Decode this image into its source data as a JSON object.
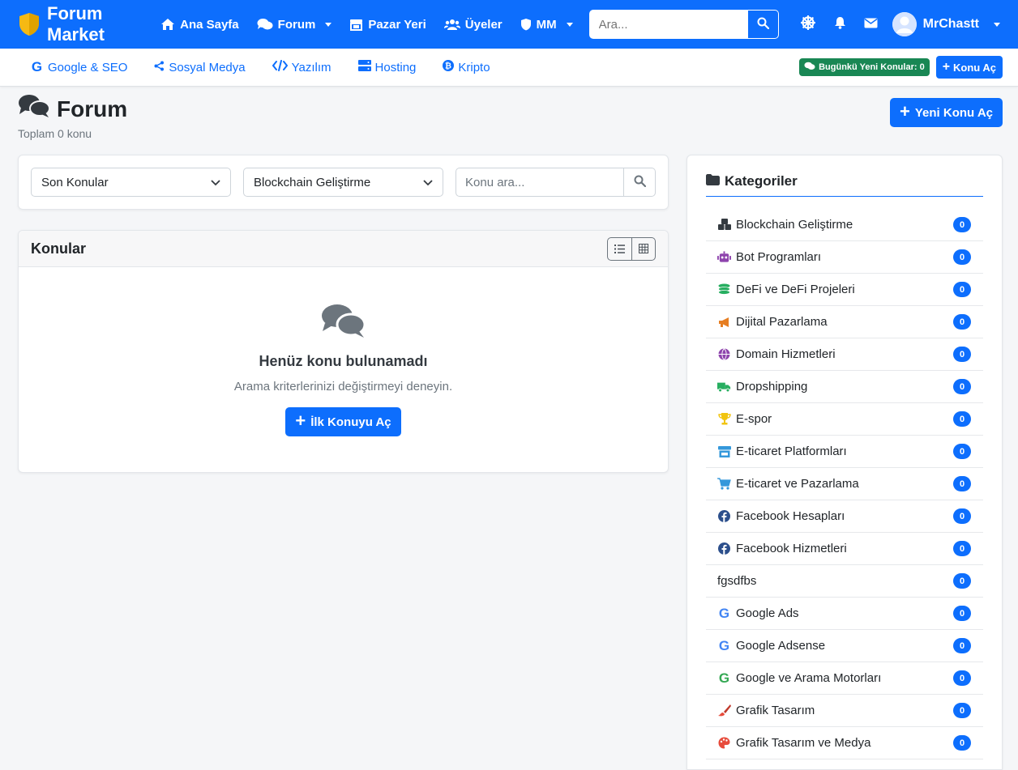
{
  "brand": {
    "name": "Forum Market"
  },
  "topnav": {
    "items": [
      {
        "label": "Ana Sayfa",
        "icon": "home-icon"
      },
      {
        "label": "Forum",
        "icon": "comments-icon",
        "dropdown": true
      },
      {
        "label": "Pazar Yeri",
        "icon": "store-icon"
      },
      {
        "label": "Üyeler",
        "icon": "users-icon"
      },
      {
        "label": "MM",
        "icon": "shield-icon",
        "dropdown": true
      }
    ],
    "search_placeholder": "Ara...",
    "username": "MrChastt"
  },
  "subnav": {
    "items": [
      {
        "label": "Google & SEO",
        "icon": "google-icon"
      },
      {
        "label": "Sosyal Medya",
        "icon": "share-icon"
      },
      {
        "label": "Yazılım",
        "icon": "code-icon"
      },
      {
        "label": "Hosting",
        "icon": "server-icon"
      },
      {
        "label": "Kripto",
        "icon": "bitcoin-icon"
      }
    ],
    "today_badge": "Bugünkü Yeni Konular: 0",
    "new_topic_small": "Konu Aç"
  },
  "page": {
    "title": "Forum",
    "subtitle": "Toplam 0 konu",
    "new_topic_button": "Yeni Konu Aç"
  },
  "filters": {
    "sort_selected": "Son Konular",
    "category_selected": "Blockchain Geliştirme",
    "search_placeholder": "Konu ara..."
  },
  "topics": {
    "title": "Konular",
    "empty_title": "Henüz konu bulunamadı",
    "empty_text": "Arama kriterlerinizi değiştirmeyi deneyin.",
    "first_topic_button": "İlk Konuyu Aç"
  },
  "sidebar": {
    "title": "Kategoriler",
    "categories": [
      {
        "label": "Blockchain Geliştirme",
        "count": "0",
        "icon": "cubes-icon",
        "color": "#343a40"
      },
      {
        "label": "Bot Programları",
        "count": "0",
        "icon": "robot-icon",
        "color": "#8e44ad"
      },
      {
        "label": "DeFi ve DeFi Projeleri",
        "count": "0",
        "icon": "coins-icon",
        "color": "#27ae60"
      },
      {
        "label": "Dijital Pazarlama",
        "count": "0",
        "icon": "megaphone-icon",
        "color": "#e67e22"
      },
      {
        "label": "Domain Hizmetleri",
        "count": "0",
        "icon": "globe-icon",
        "color": "#8e44ad"
      },
      {
        "label": "Dropshipping",
        "count": "0",
        "icon": "truck-icon",
        "color": "#27ae60"
      },
      {
        "label": "E-spor",
        "count": "0",
        "icon": "trophy-icon",
        "color": "#f1c40f"
      },
      {
        "label": "E-ticaret Platformları",
        "count": "0",
        "icon": "store-icon",
        "color": "#3498db"
      },
      {
        "label": "E-ticaret ve Pazarlama",
        "count": "0",
        "icon": "cart-icon",
        "color": "#3498db"
      },
      {
        "label": "Facebook Hesapları",
        "count": "0",
        "icon": "facebook-icon",
        "color": "#2c4f8c"
      },
      {
        "label": "Facebook Hizmetleri",
        "count": "0",
        "icon": "facebook-icon",
        "color": "#2c4f8c"
      },
      {
        "label": "fgsdfbs",
        "count": "0",
        "icon": "",
        "color": ""
      },
      {
        "label": "Google Ads",
        "count": "0",
        "icon": "google-icon",
        "color": "#4285f4"
      },
      {
        "label": "Google Adsense",
        "count": "0",
        "icon": "google-icon",
        "color": "#4285f4"
      },
      {
        "label": "Google ve Arama Motorları",
        "count": "0",
        "icon": "google-icon",
        "color": "#34a853"
      },
      {
        "label": "Grafik Tasarım",
        "count": "0",
        "icon": "brush-icon",
        "color": "#e74c3c"
      },
      {
        "label": "Grafik Tasarım ve Medya",
        "count": "0",
        "icon": "palette-icon",
        "color": "#e74c3c"
      }
    ]
  }
}
